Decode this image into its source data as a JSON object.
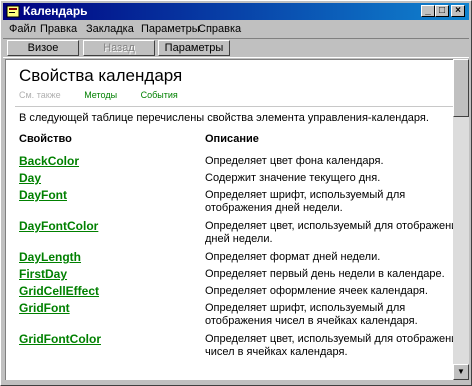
{
  "window": {
    "title": "Календарь",
    "controls": [
      "minimize",
      "maximize",
      "close"
    ]
  },
  "menu": [
    "Файл",
    "Правка",
    "Закладка",
    "Параметры",
    "Справка"
  ],
  "toolbar": {
    "show_help": "Визое справки",
    "back": "Назад",
    "options": "Параметры"
  },
  "page": {
    "title": "Свойства календаря",
    "sublinks": {
      "current": "См. также",
      "methods": "Методы",
      "events": "События"
    },
    "intro": "В следующей таблице перечислены свойства элемента управления-календаря.",
    "table": {
      "col_property": "Свойство",
      "col_description": "Описание",
      "rows": [
        {
          "prop": "BackColor",
          "desc": "Определяет цвет фона календаря."
        },
        {
          "prop": "Day",
          "desc": "Содержит значение текущего дня."
        },
        {
          "prop": "DayFont",
          "desc": "Определяет шрифт, используемый для отображения дней недели."
        },
        {
          "prop": "DayFontColor",
          "desc": "Определяет цвет, используемый для отображения дней недели."
        },
        {
          "prop": "DayLength",
          "desc": "Определяет формат дней недели."
        },
        {
          "prop": "FirstDay",
          "desc": "Определяет первый день недели в календаре."
        },
        {
          "prop": "GridCellEffect",
          "desc": "Определяет оформление ячеек календаря."
        },
        {
          "prop": "GridFont",
          "desc": "Определяет шрифт, используемый для отображения чисел в ячейках календаря."
        },
        {
          "prop": "GridFontColor",
          "desc": "Определяет цвет, используемый для отображения чисел в ячейках календаря."
        }
      ]
    }
  },
  "colors": {
    "titlebar_start": "#000080",
    "titlebar_end": "#1084d0",
    "link": "#008000"
  }
}
